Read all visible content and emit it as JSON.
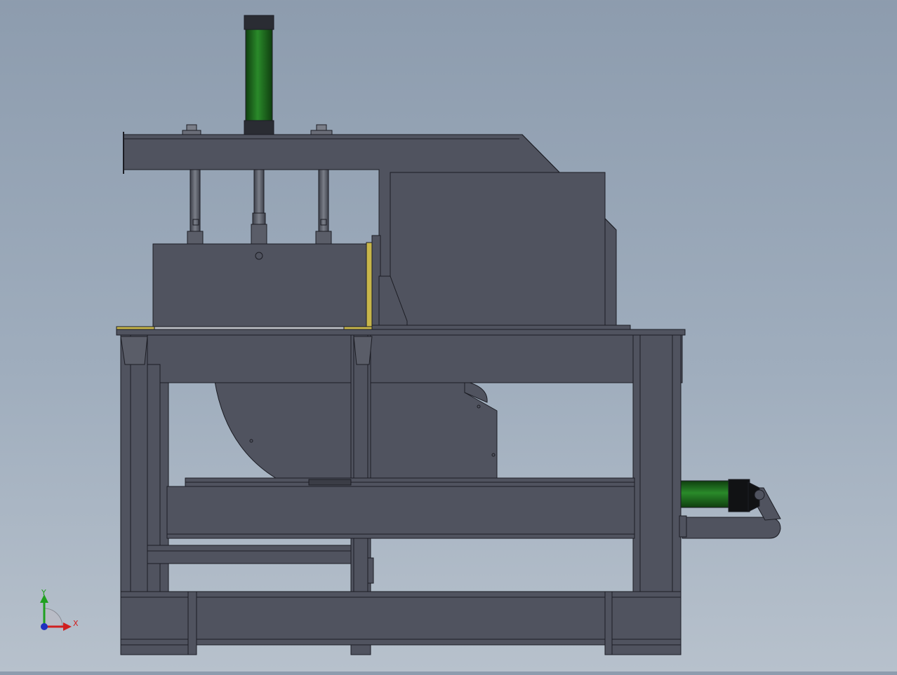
{
  "viewport": {
    "background_top": "#8d9cae",
    "background_bottom": "#b7c1cc",
    "body_color": "#50535f",
    "edge_color": "#1c1d24",
    "cylinder_color": "#1d6b1d",
    "accent_yellow": "#c8b64a"
  },
  "triad": {
    "x_label": "X",
    "y_label": "Y",
    "x_color": "#d02020",
    "y_color": "#20a020",
    "z_color": "#2030c0"
  }
}
